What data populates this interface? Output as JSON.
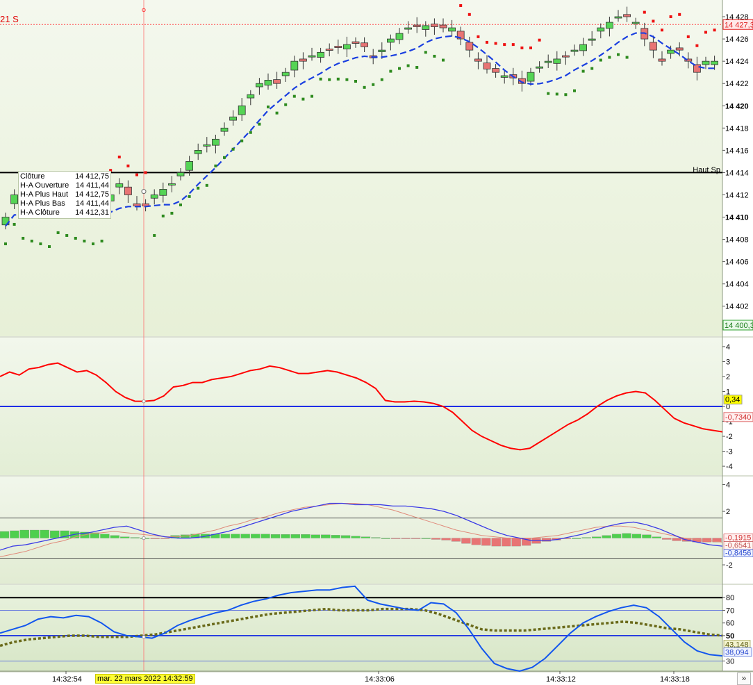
{
  "instrument_label": "21 S",
  "price_axis": {
    "ticks": [
      "14 428",
      "14 426",
      "14 424",
      "14 422",
      "14 420",
      "14 418",
      "14 416",
      "14 414",
      "14 412",
      "14 410",
      "14 408",
      "14 406",
      "14 404",
      "14 402"
    ],
    "bold_ticks": [
      "14 420",
      "14 410"
    ],
    "current_price": "14 427,3",
    "bottom_price": "14 400,3",
    "range": [
      14399.3,
      14429.5
    ],
    "level_line": 14414,
    "level_label": "Haut Sp",
    "colors": {
      "current": "#e02020",
      "bottom": "#2aa02a"
    }
  },
  "tooltip": {
    "rows": [
      {
        "label": "Clôture",
        "value": "14 412,75"
      },
      {
        "label": "H-A Ouverture",
        "value": "14 411,44"
      },
      {
        "label": "H-A Plus Haut",
        "value": "14 412,75"
      },
      {
        "label": "H-A Plus Bas",
        "value": "14 411,44"
      },
      {
        "label": "H-A Clôture",
        "value": "14 412,31"
      }
    ]
  },
  "time_axis": {
    "labels": [
      "14:32:54",
      "14:33:06",
      "14:33:12",
      "14:33:18"
    ],
    "cursor_date": "mar. 22 mars 2022 14:32:59",
    "nav": "»"
  },
  "osc1": {
    "ticks": [
      "4",
      "3",
      "2",
      "1",
      "0",
      "-1",
      "-2",
      "-3",
      "-4"
    ],
    "value_label": "0,34",
    "value2_label": "-0,7340",
    "range": [
      -4.6,
      4.6
    ],
    "ref_line": 0,
    "colors": {
      "line": "#ff0000",
      "ref": "#1e2ee6",
      "value": "#ffff00"
    }
  },
  "osc2": {
    "ticks": [
      "4",
      "2",
      "-2"
    ],
    "labels": [
      "-0,1915",
      "-0,6541",
      "-0,8456"
    ],
    "range": [
      -3.4,
      4.6
    ],
    "bands": [
      1.5,
      -1.5
    ],
    "colors": {
      "macd": "#3a3ae6",
      "signal": "#e08a7a",
      "hist_pos": "#4ecf4e",
      "hist_neg": "#e87474"
    }
  },
  "osc3": {
    "ticks": [
      "80",
      "70",
      "60",
      "50",
      "30"
    ],
    "bold_tick": "50",
    "labels": [
      "43,148",
      "38,094"
    ],
    "range": [
      22,
      90
    ],
    "level_lines": [
      80,
      70,
      50,
      30
    ],
    "colors": {
      "k": "#1155ee",
      "d": "#6a6a1a"
    }
  },
  "chart_data": [
    {
      "type": "candlestick",
      "title": "",
      "x": [
        0,
        1,
        2,
        3,
        4,
        5,
        6,
        7,
        8,
        9,
        10,
        11,
        12,
        13,
        14,
        15,
        16,
        17,
        18,
        19,
        20,
        21,
        22,
        23,
        24,
        25,
        26,
        27,
        28,
        29,
        30,
        31,
        32,
        33,
        34,
        35,
        36,
        37,
        38,
        39,
        40,
        41,
        42,
        43,
        44,
        45,
        46,
        47,
        48,
        49,
        50,
        51,
        52,
        53,
        54,
        55,
        56,
        57,
        58,
        59,
        60,
        61,
        62,
        63,
        64,
        65,
        66,
        67,
        68,
        69,
        70,
        71,
        72,
        73,
        74,
        75,
        76,
        77,
        78,
        79,
        80,
        81
      ],
      "close": [
        14410,
        14412,
        14411,
        14411,
        14411,
        14411,
        14411,
        14411,
        14411,
        14411,
        14411,
        14411.5,
        14412,
        14413,
        14412,
        14411,
        14411,
        14412,
        14412.5,
        14413,
        14414,
        14415,
        14416,
        14416.5,
        14417,
        14418,
        14419,
        14420,
        14421,
        14422,
        14422.3,
        14422,
        14423,
        14424,
        14424,
        14424.5,
        14424.8,
        14425,
        14425.3,
        14425.5,
        14425.6,
        14425.3,
        14424.3,
        14425,
        14426,
        14426.5,
        14427,
        14427.1,
        14427.2,
        14427.1,
        14427,
        14427,
        14426,
        14425,
        14424,
        14423.3,
        14423,
        14422.7,
        14422.5,
        14422,
        14423,
        14423.5,
        14424,
        14424.2,
        14424.4,
        14425,
        14425.5,
        14426,
        14427,
        14427.5,
        14428,
        14428,
        14427.5,
        14426,
        14425,
        14424,
        14425,
        14425,
        14424,
        14423,
        14424,
        14424
      ],
      "series_sar": "dots above/below",
      "series_ma": "dashed blue"
    },
    {
      "type": "line",
      "name": "",
      "values": [
        2.0,
        2.3,
        2.1,
        2.5,
        2.6,
        2.8,
        2.9,
        2.6,
        2.3,
        2.4,
        2.1,
        1.6,
        1.0,
        0.6,
        0.35,
        0.34,
        0.4,
        0.7,
        1.3,
        1.4,
        1.6,
        1.6,
        1.8,
        1.9,
        2.0,
        2.2,
        2.4,
        2.5,
        2.7,
        2.6,
        2.4,
        2.2,
        2.2,
        2.3,
        2.4,
        2.3,
        2.1,
        1.9,
        1.6,
        1.2,
        0.4,
        0.3,
        0.3,
        0.35,
        0.3,
        0.2,
        0.0,
        -0.4,
        -1.0,
        -1.6,
        -2.0,
        -2.3,
        -2.6,
        -2.8,
        -2.9,
        -2.8,
        -2.4,
        -2.0,
        -1.6,
        -1.2,
        -0.9,
        -0.5,
        0.0,
        0.4,
        0.7,
        0.9,
        1.0,
        0.9,
        0.4,
        -0.2,
        -0.8,
        -1.1,
        -1.3,
        -1.5,
        -1.6,
        -1.7
      ],
      "ref": 0
    },
    {
      "type": "bar+line",
      "macd": [
        -0.9,
        -0.6,
        -0.5,
        -0.3,
        -0.1,
        0.1,
        0.3,
        0.4,
        0.6,
        0.8,
        0.9,
        0.6,
        0.3,
        0.1,
        0.0,
        0.0,
        0.1,
        0.3,
        0.5,
        0.8,
        1.1,
        1.4,
        1.7,
        2.0,
        2.2,
        2.4,
        2.6,
        2.6,
        2.5,
        2.5,
        2.5,
        2.4,
        2.4,
        2.3,
        2.2,
        2.0,
        1.7,
        1.3,
        0.9,
        0.5,
        0.2,
        0.0,
        -0.2,
        -0.2,
        -0.1,
        0.1,
        0.3,
        0.6,
        0.9,
        1.1,
        1.2,
        1.0,
        0.7,
        0.3,
        -0.1,
        -0.3,
        -0.5,
        -0.6
      ],
      "signal": [
        -1.4,
        -1.2,
        -1.0,
        -0.7,
        -0.4,
        -0.2,
        0.1,
        0.3,
        0.4,
        0.5,
        0.4,
        0.3,
        0.2,
        0.1,
        0.1,
        0.2,
        0.4,
        0.6,
        0.9,
        1.1,
        1.4,
        1.6,
        1.9,
        2.1,
        2.3,
        2.4,
        2.5,
        2.6,
        2.6,
        2.5,
        2.3,
        2.1,
        1.8,
        1.5,
        1.2,
        0.9,
        0.6,
        0.4,
        0.2,
        0.1,
        0.0,
        0.0,
        0.0,
        0.1,
        0.2,
        0.4,
        0.6,
        0.8,
        0.9,
        0.9,
        0.8,
        0.6,
        0.4,
        0.2,
        0.0,
        -0.1,
        -0.2,
        -0.3
      ],
      "histogram": [
        0.5,
        0.55,
        0.6,
        0.6,
        0.6,
        0.55,
        0.55,
        0.5,
        0.45,
        0.4,
        0.3,
        0.2,
        0.1,
        0.05,
        0.0,
        -0.05,
        -0.05,
        0.2,
        0.25,
        0.3,
        0.3,
        0.3,
        0.3,
        0.3,
        0.3,
        0.3,
        0.3,
        0.28,
        0.28,
        0.28,
        0.28,
        0.25,
        0.25,
        0.22,
        0.2,
        0.15,
        0.1,
        0.05,
        0.0,
        -0.05,
        -0.05,
        -0.05,
        0.0,
        -0.1,
        -0.15,
        -0.25,
        -0.4,
        -0.5,
        -0.55,
        -0.6,
        -0.6,
        -0.6,
        -0.55,
        -0.4,
        -0.25,
        -0.15,
        -0.05,
        0.0,
        0.05,
        0.1,
        0.2,
        0.3,
        0.35,
        0.3,
        0.25,
        0.1,
        -0.1,
        -0.2,
        -0.25,
        -0.3,
        -0.3,
        -0.3
      ]
    },
    {
      "type": "line",
      "k": [
        52,
        55,
        58,
        63,
        65,
        64,
        66,
        65,
        60,
        53,
        50,
        49,
        48,
        52,
        58,
        62,
        65,
        68,
        70,
        74,
        77,
        79,
        82,
        84,
        85,
        86,
        86,
        88,
        89,
        78,
        75,
        73,
        71,
        70,
        76,
        75,
        68,
        55,
        40,
        28,
        24,
        22,
        25,
        32,
        42,
        52,
        60,
        65,
        69,
        72,
        74,
        72,
        65,
        55,
        45,
        38,
        35,
        34
      ],
      "d": [
        42,
        45,
        47,
        48,
        49,
        50,
        50,
        49,
        49,
        49,
        50,
        51,
        53,
        55,
        57,
        59,
        61,
        63,
        65,
        67,
        68,
        69,
        70,
        71,
        70,
        70,
        70,
        71,
        71,
        71,
        70,
        67,
        63,
        59,
        55,
        54,
        54,
        54,
        55,
        56,
        57,
        58,
        59,
        60,
        61,
        60,
        58,
        56,
        55,
        53,
        51,
        50
      ],
      "levels": [
        80,
        70,
        50,
        30
      ]
    }
  ]
}
